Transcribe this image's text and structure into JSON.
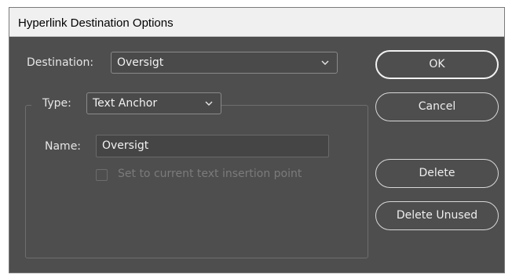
{
  "dialog": {
    "title": "Hyperlink Destination Options"
  },
  "destination": {
    "label": "Destination:",
    "value": "Oversigt",
    "icon": "chevron-down-icon"
  },
  "type": {
    "label": "Type:",
    "value": "Text Anchor",
    "icon": "chevron-down-icon"
  },
  "name": {
    "label": "Name:",
    "value": "Oversigt"
  },
  "insertion_point": {
    "label": "Set to current text insertion point",
    "checked": false,
    "enabled": false
  },
  "buttons": {
    "ok": "OK",
    "cancel": "Cancel",
    "delete": "Delete",
    "delete_unused": "Delete Unused"
  },
  "colors": {
    "dialog_background": "#4e4e4e",
    "titlebar_background": "#f0f0f0",
    "text": "#e6e6e6",
    "disabled_text": "#7b7b7b"
  }
}
